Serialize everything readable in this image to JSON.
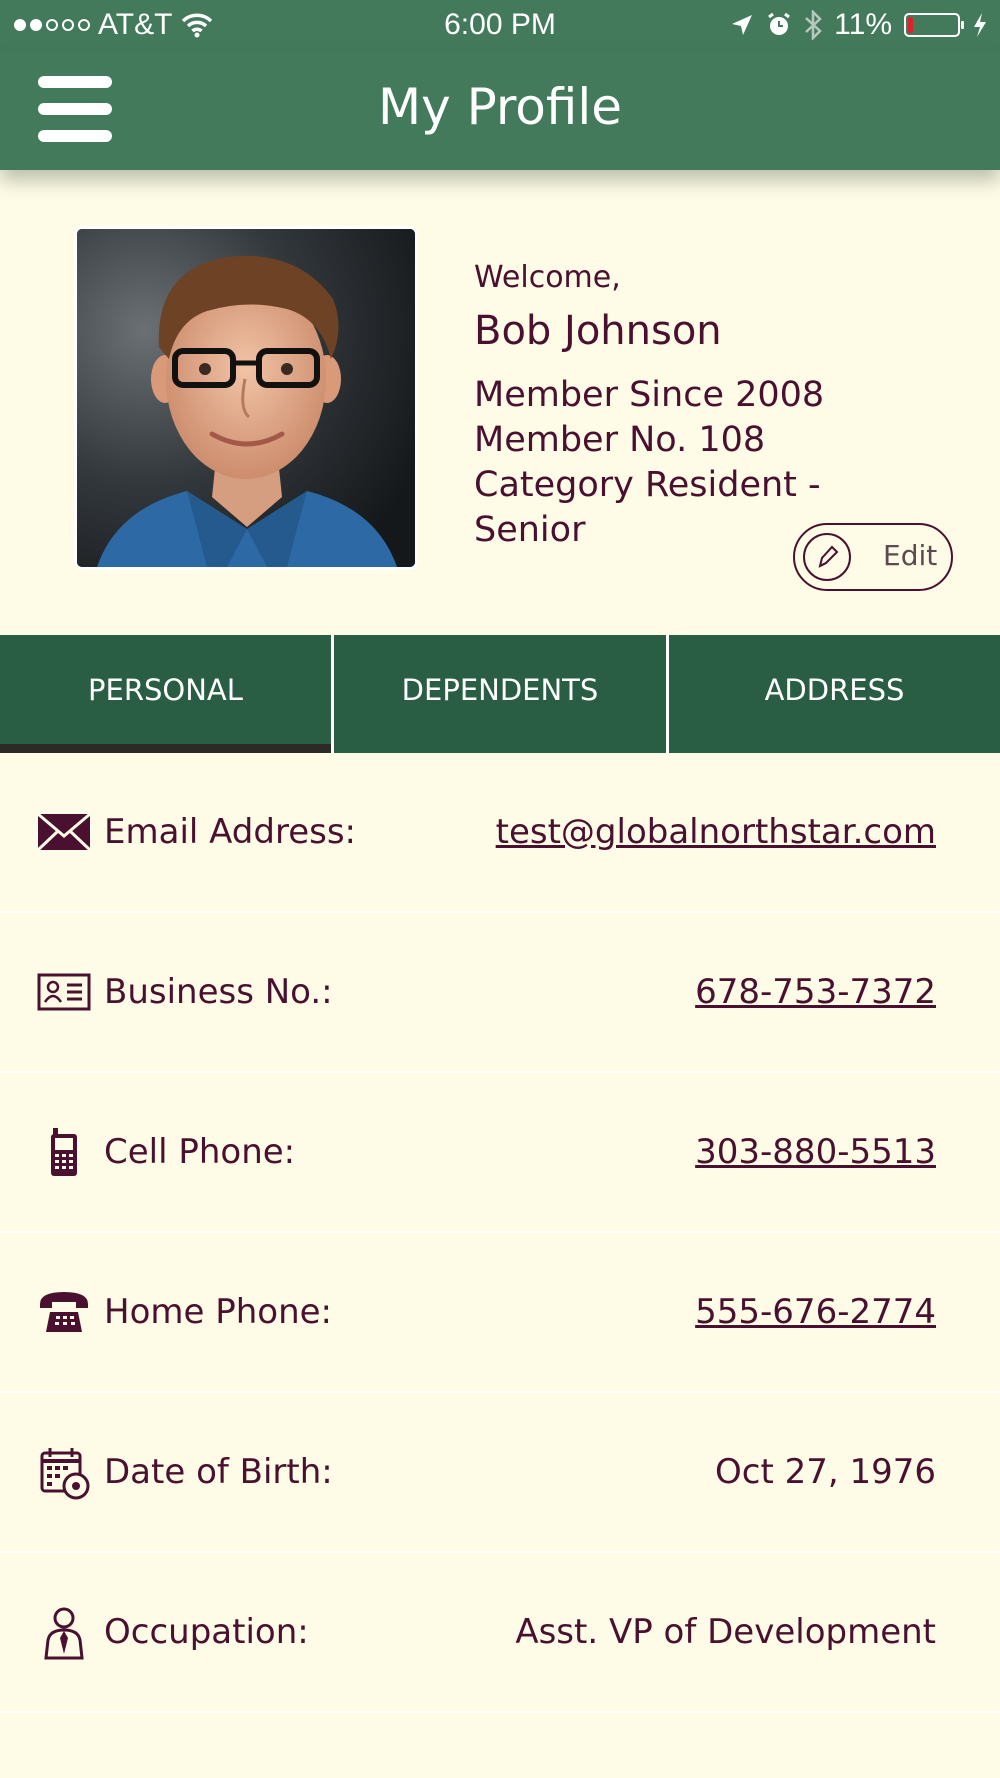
{
  "status_bar": {
    "carrier": "AT&T",
    "time": "6:00 PM",
    "battery": "11%",
    "battery_level": 0.11,
    "signal_bars": 2
  },
  "header": {
    "title": "My Profile"
  },
  "profile": {
    "welcome": "Welcome,",
    "name": "Bob Johnson",
    "member_since": "Member Since 2008",
    "member_no": "Member No. 108",
    "category_line1": "Category Resident -",
    "category_line2": "Senior",
    "edit_label": "Edit"
  },
  "tabs": [
    {
      "label": "PERSONAL",
      "active": true
    },
    {
      "label": "DEPENDENTS",
      "active": false
    },
    {
      "label": "ADDRESS",
      "active": false
    }
  ],
  "rows": [
    {
      "icon": "envelope-icon",
      "label": "Email Address:",
      "value": "test@globalnorthstar.com",
      "link": true
    },
    {
      "icon": "business-card-icon",
      "label": "Business No.:",
      "value": "678-753-7372",
      "link": true
    },
    {
      "icon": "cell-phone-icon",
      "label": "Cell Phone:",
      "value": "303-880-5513",
      "link": true
    },
    {
      "icon": "home-phone-icon",
      "label": "Home Phone:",
      "value": "555-676-2774",
      "link": true
    },
    {
      "icon": "calendar-icon",
      "label": "Date of Birth:",
      "value": "Oct 27, 1976",
      "link": false
    },
    {
      "icon": "occupation-icon",
      "label": "Occupation:",
      "value": "Asst. VP of Development",
      "link": false
    }
  ],
  "colors": {
    "header_green": "#437a5c",
    "tab_green": "#2a5e44",
    "text_maroon": "#4a1030",
    "background": "#fefbe6"
  }
}
